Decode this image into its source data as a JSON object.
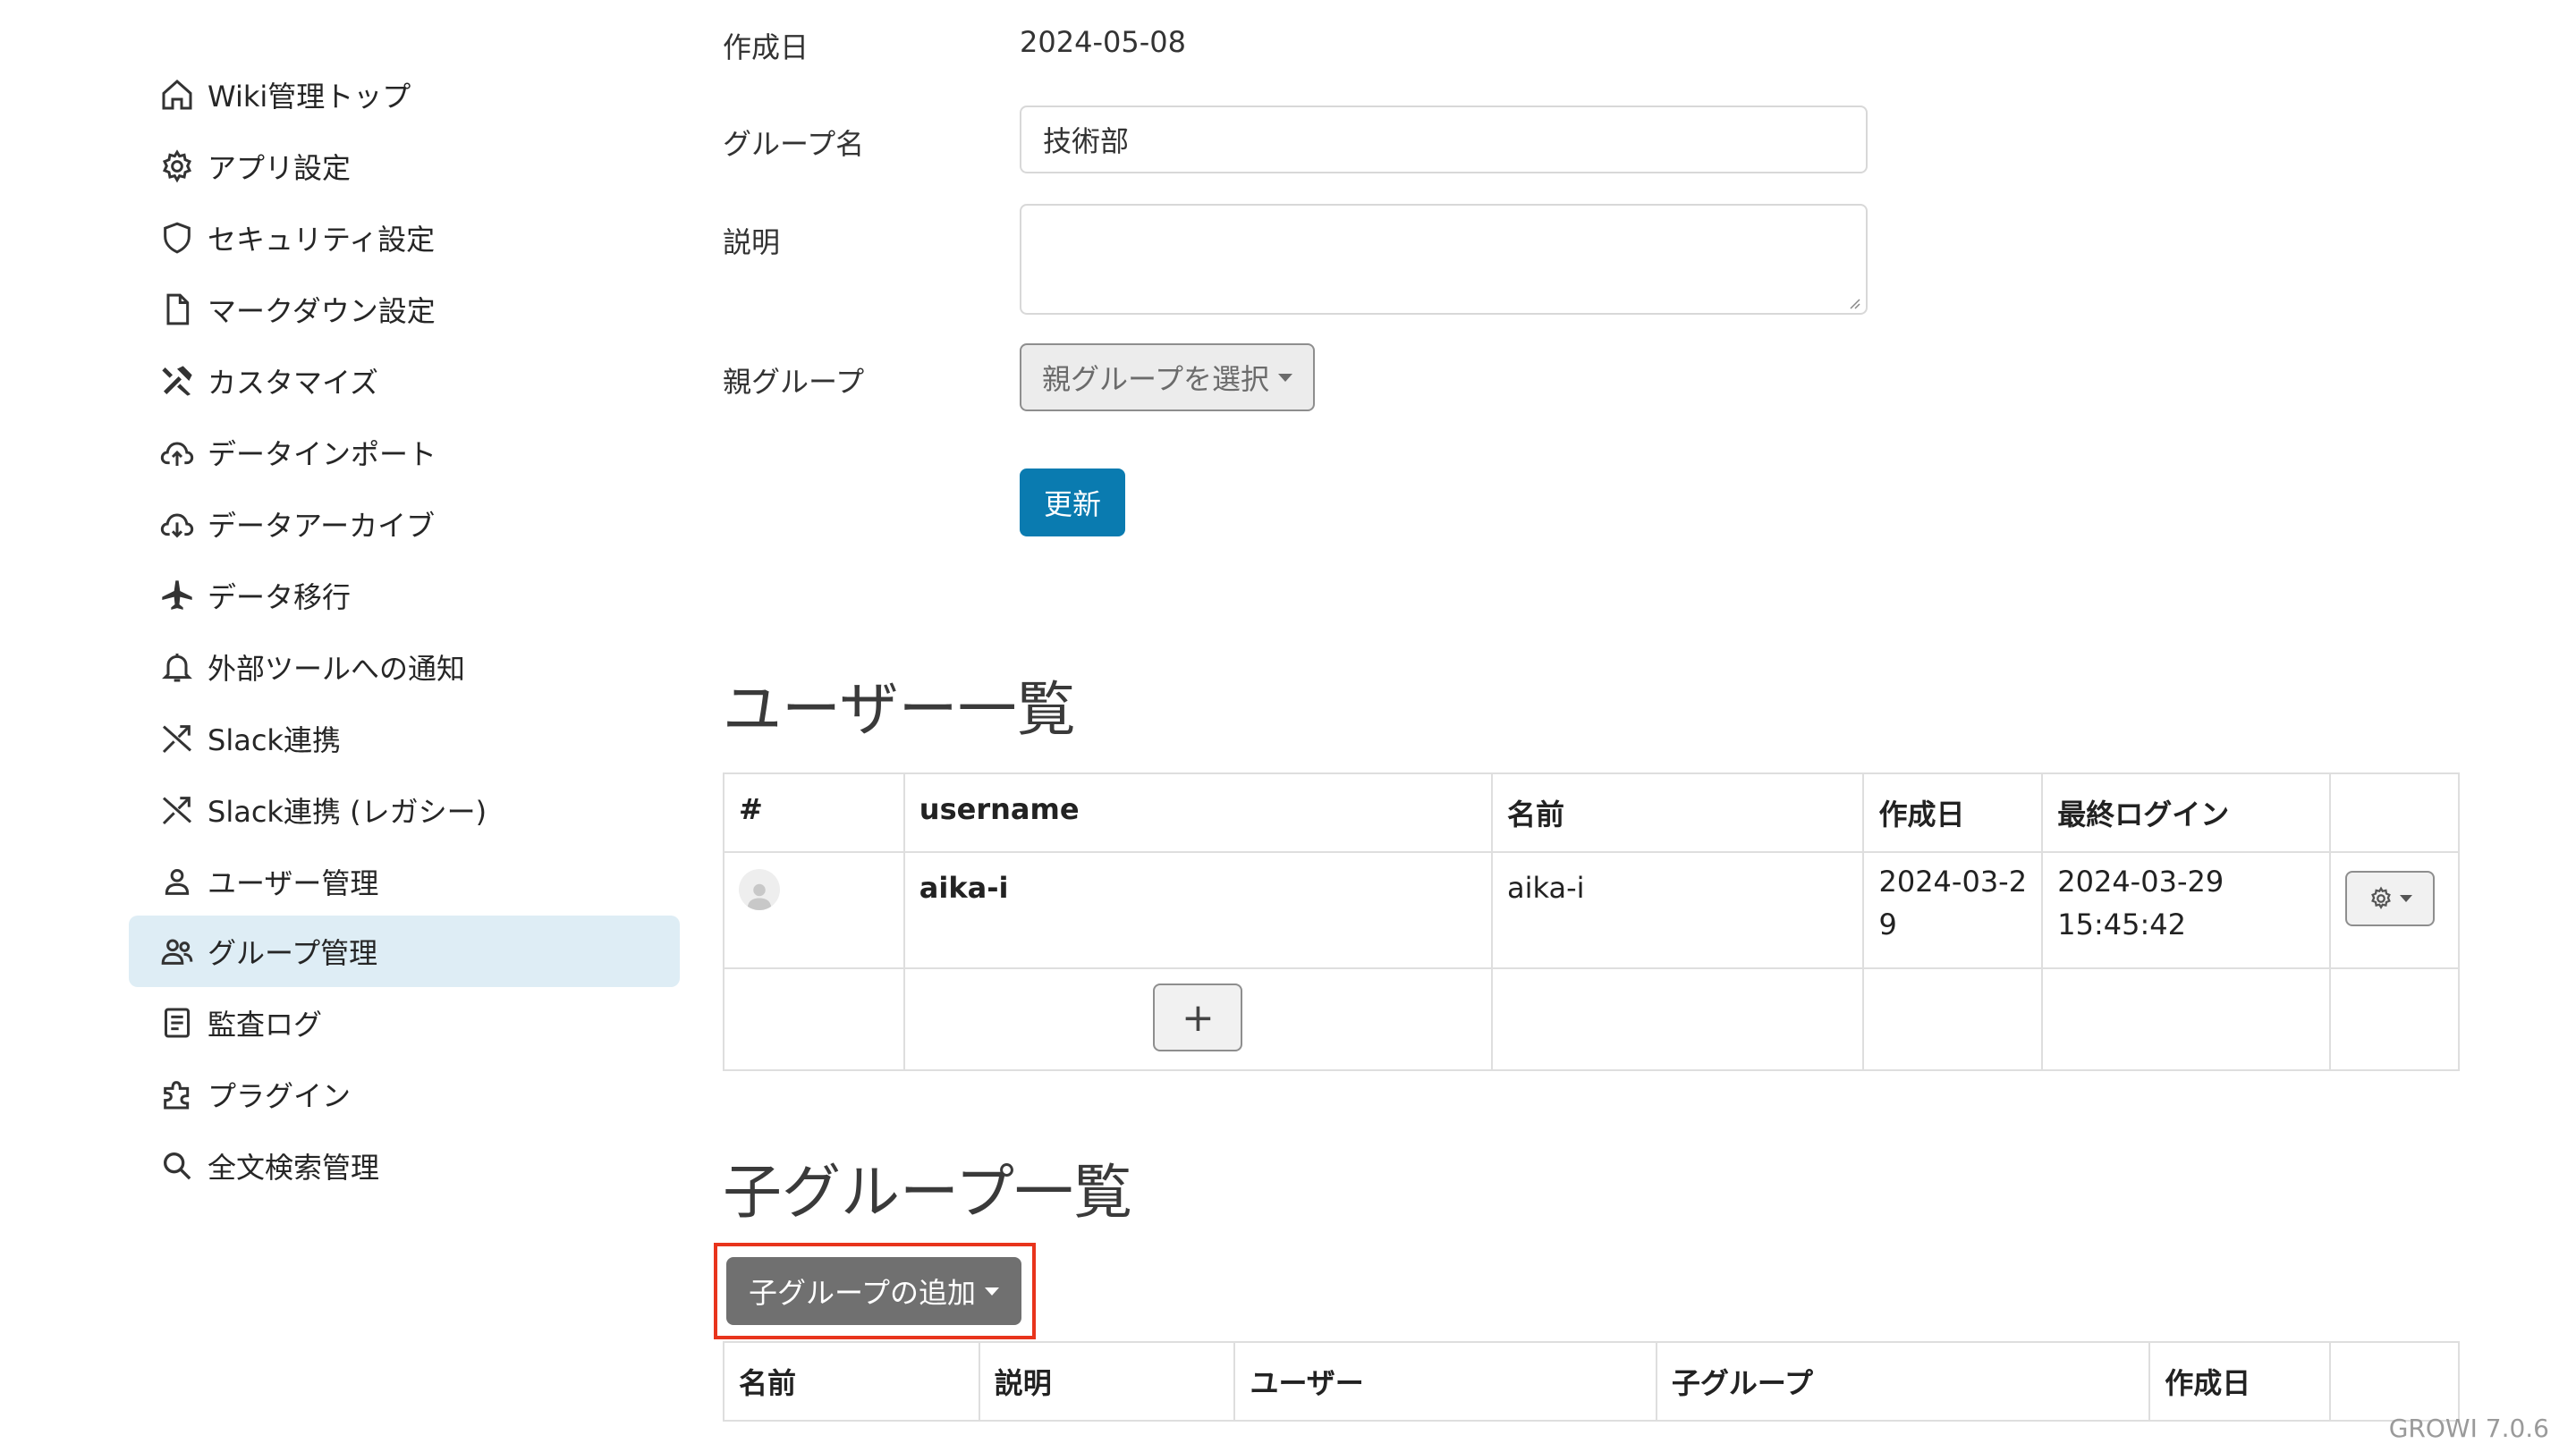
{
  "sidebar": {
    "items": [
      {
        "label": "Wiki管理トップ",
        "icon": "home-icon"
      },
      {
        "label": "アプリ設定",
        "icon": "gear-icon"
      },
      {
        "label": "セキュリティ設定",
        "icon": "shield-icon"
      },
      {
        "label": "マークダウン設定",
        "icon": "file-icon"
      },
      {
        "label": "カスタマイズ",
        "icon": "tools-icon"
      },
      {
        "label": "データインポート",
        "icon": "cloud-upload-icon"
      },
      {
        "label": "データアーカイブ",
        "icon": "cloud-download-icon"
      },
      {
        "label": "データ移行",
        "icon": "airplane-icon"
      },
      {
        "label": "外部ツールへの通知",
        "icon": "bell-icon"
      },
      {
        "label": "Slack連携",
        "icon": "shuffle-icon"
      },
      {
        "label": "Slack連携 (レガシー)",
        "icon": "shuffle-icon"
      },
      {
        "label": "ユーザー管理",
        "icon": "person-icon"
      },
      {
        "label": "グループ管理",
        "icon": "people-icon",
        "active": true
      },
      {
        "label": "監査ログ",
        "icon": "document-list-icon"
      },
      {
        "label": "プラグイン",
        "icon": "puzzle-icon"
      },
      {
        "label": "全文検索管理",
        "icon": "search-icon"
      }
    ]
  },
  "form": {
    "created_label": "作成日",
    "created_value": "2024-05-08",
    "name_label": "グループ名",
    "name_value": "技術部",
    "description_label": "説明",
    "description_value": "",
    "parent_label": "親グループ",
    "parent_select": "親グループを選択",
    "update_button": "更新"
  },
  "users": {
    "title": "ユーザー一覧",
    "columns": [
      "#",
      "username",
      "名前",
      "作成日",
      "最終ログイン",
      ""
    ],
    "rows": [
      {
        "username": "aika-i",
        "name": "aika-i",
        "created": "2024-03-29",
        "last_login": "2024-03-29 15:45:42"
      }
    ],
    "add_button": "+"
  },
  "child_groups": {
    "title": "子グループ一覧",
    "add_button": "子グループの追加",
    "columns": [
      "名前",
      "説明",
      "ユーザー",
      "子グループ",
      "作成日",
      ""
    ]
  },
  "footer": {
    "version": "GROWI 7.0.6"
  },
  "colors": {
    "accent": "#0a7bb0",
    "active_nav": "#deedf5",
    "highlight_border": "#e8341c"
  }
}
